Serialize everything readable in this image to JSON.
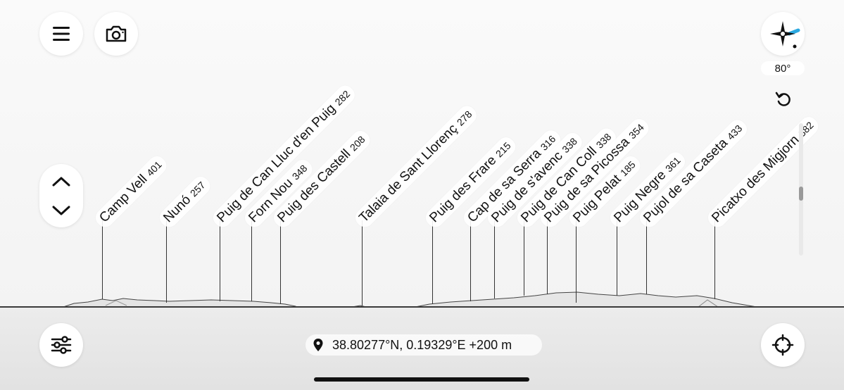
{
  "toolbar": {
    "menu_icon": "hamburger-menu-icon",
    "camera_icon": "camera-icon",
    "settings_icon": "sliders-icon",
    "locate_icon": "crosshair-icon"
  },
  "compass": {
    "icon": "compass-star-icon",
    "heading": "80°",
    "reset_icon": "rotate-ccw-icon"
  },
  "zoom": {
    "up_icon": "chevron-up-icon",
    "down_icon": "chevron-down-icon"
  },
  "location": {
    "pin_icon": "location-pin-icon",
    "text": "38.80277°N, 0.19329°E +200 m"
  },
  "peaks": [
    {
      "name": "Camp Vell",
      "elevation": "401"
    },
    {
      "name": "Nunó",
      "elevation": "257"
    },
    {
      "name": "Puig de Can Lluc d'en Puig",
      "elevation": "282"
    },
    {
      "name": "Forn Nou",
      "elevation": "348"
    },
    {
      "name": "Puig des Castell",
      "elevation": "208"
    },
    {
      "name": "Talaia de Sant Llorenç",
      "elevation": "278"
    },
    {
      "name": "Puig des Frare",
      "elevation": "215"
    },
    {
      "name": "Cap de sa Serra",
      "elevation": "316"
    },
    {
      "name": "Puig de s'avenc",
      "elevation": "338"
    },
    {
      "name": "Puig de Can Coll",
      "elevation": "338"
    },
    {
      "name": "Puig de sa Picossa",
      "elevation": "354"
    },
    {
      "name": "Puig Pelat",
      "elevation": "185"
    },
    {
      "name": "Puig Negre",
      "elevation": "361"
    },
    {
      "name": "Pujol de sa Caseta",
      "elevation": "433"
    },
    {
      "name": "Picatxo des Migjorn",
      "elevation": "382"
    }
  ],
  "colors": {
    "accent_blue": "#2ba8e0",
    "icon": "#111111",
    "line": "#333333"
  }
}
